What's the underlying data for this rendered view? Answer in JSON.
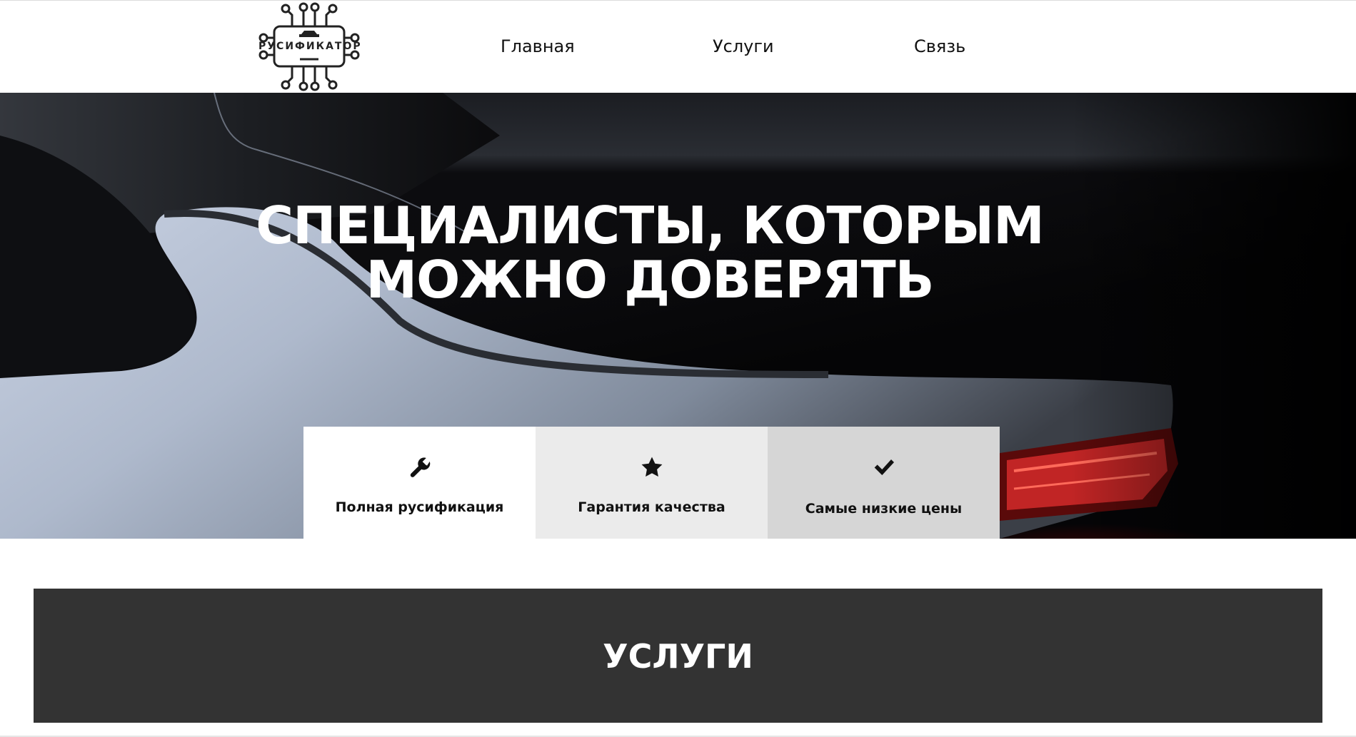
{
  "header": {
    "logo_text": "РУСИФИКАТОР",
    "nav": [
      {
        "label": "Главная"
      },
      {
        "label": "Услуги"
      },
      {
        "label": "Связь"
      }
    ]
  },
  "hero": {
    "title_line1": "СПЕЦИАЛИСТЫ, КОТОРЫМ",
    "title_line2": "МОЖНО ДОВЕРЯТЬ",
    "features": [
      {
        "label": "Полная русификация",
        "icon": "wrench-icon"
      },
      {
        "label": "Гарантия качества",
        "icon": "star-icon"
      },
      {
        "label": "Самые низкие цены",
        "icon": "checkmark-icon"
      }
    ]
  },
  "services": {
    "title": "УСЛУГИ"
  },
  "colors": {
    "services_bg": "#333333",
    "card1_bg": "#ffffff",
    "card2_bg": "#ebebeb",
    "card3_bg": "#d6d6d6",
    "taillight": "#d42a2a"
  }
}
